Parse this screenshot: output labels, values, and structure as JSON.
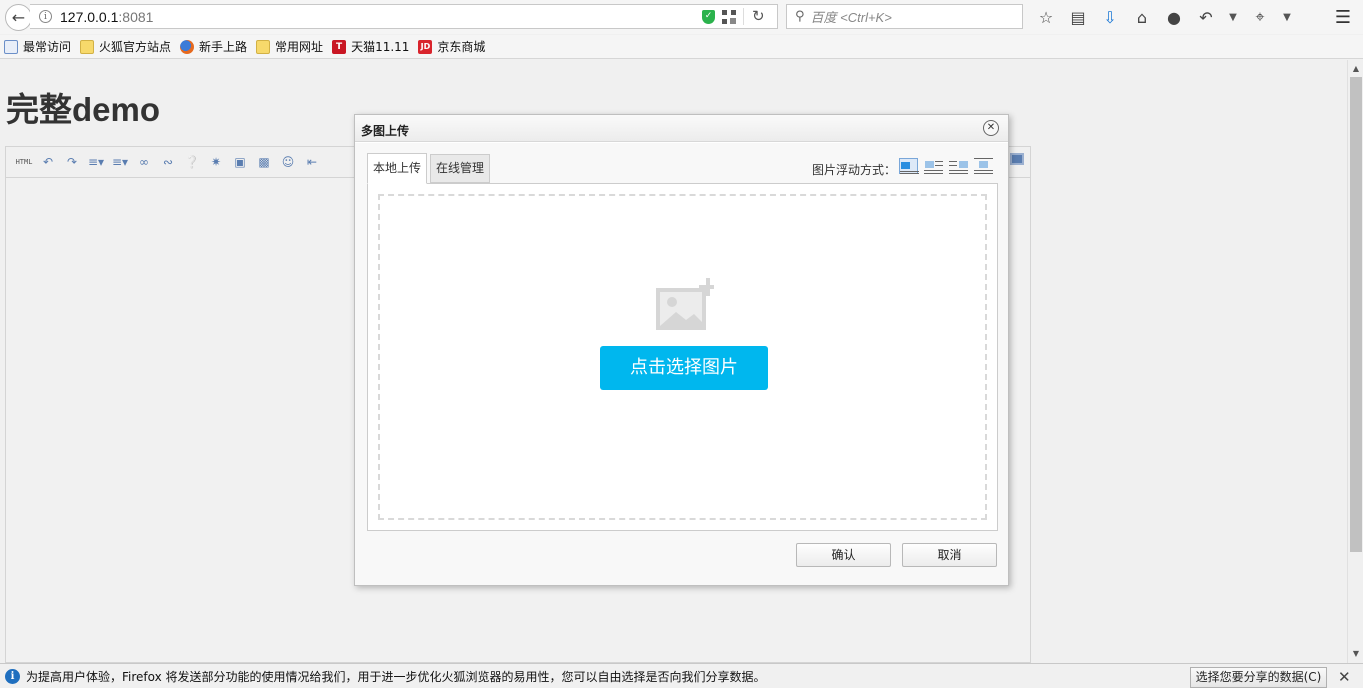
{
  "browser": {
    "url_host": "127.0.0.1",
    "url_port": ":8081",
    "search_placeholder": "百度 <Ctrl+K>"
  },
  "bookmarks": [
    {
      "label": "最常访问",
      "icon": "doc-icon"
    },
    {
      "label": "火狐官方站点",
      "icon": "folder-icon"
    },
    {
      "label": "新手上路",
      "icon": "firefox-icon"
    },
    {
      "label": "常用网址",
      "icon": "folder-icon"
    },
    {
      "label": "天猫11.11",
      "icon": "tmall-icon"
    },
    {
      "label": "京东商城",
      "icon": "jd-icon"
    }
  ],
  "page": {
    "title": "完整demo",
    "toolbar_html_label": "HTML"
  },
  "dialog": {
    "title": "多图上传",
    "tabs": [
      {
        "label": "本地上传",
        "active": true
      },
      {
        "label": "在线管理",
        "active": false
      }
    ],
    "float_label": "图片浮动方式：",
    "pick_button": "点击选择图片",
    "ok_button": "确认",
    "cancel_button": "取消",
    "accent_color": "#00b7ee"
  },
  "notification": {
    "text": "为提高用户体验，Firefox 将发送部分功能的使用情况给我们，用于进一步优化火狐浏览器的易用性，您可以自由选择是否向我们分享数据。",
    "button": "选择您要分享的数据(C)"
  }
}
